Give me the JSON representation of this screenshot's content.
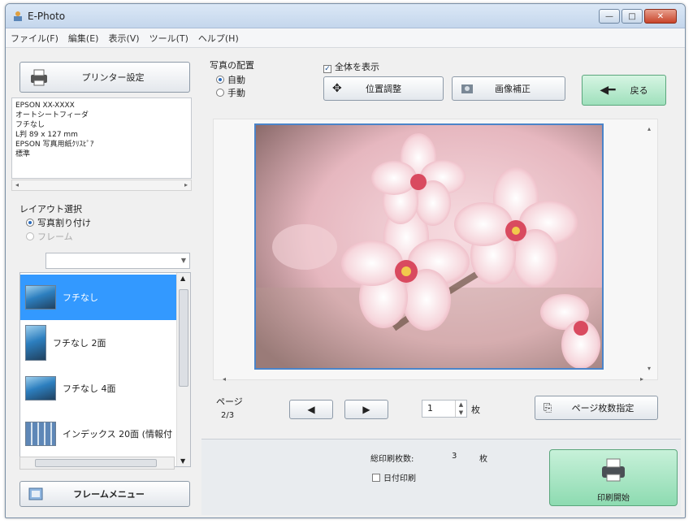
{
  "window": {
    "title": "E-Photo"
  },
  "window_controls": {
    "minimize": "—",
    "maximize": "□",
    "close": "✕"
  },
  "menu": [
    "ファイル(F)",
    "編集(E)",
    "表示(V)",
    "ツール(T)",
    "ヘルプ(H)"
  ],
  "left": {
    "printer_settings_label": "プリンター設定",
    "printer_info": [
      "EPSON XX-XXXX",
      "オートシートフィーダ",
      "フチなし",
      "L判 89 x 127 mm",
      "EPSON 写真用紙ｸﾘｽﾋﾟｱ",
      "標準"
    ],
    "layout_heading": "レイアウト選択",
    "layout_options": [
      {
        "label": "写真割り付け",
        "selected": true
      },
      {
        "label": "フレーム",
        "selected": false
      }
    ],
    "layouts": [
      {
        "label": "フチなし",
        "selected": true
      },
      {
        "label": "フチなし 2面",
        "selected": false
      },
      {
        "label": "フチなし 4面",
        "selected": false
      },
      {
        "label": "インデックス 20面 (情報付",
        "selected": false
      }
    ],
    "frame_menu_label": "フレームメニュー"
  },
  "placement": {
    "heading": "写真の配置",
    "options": [
      {
        "label": "自動",
        "selected": true
      },
      {
        "label": "手動",
        "selected": false
      }
    ]
  },
  "toolbar": {
    "show_all_label": "全体を表示",
    "show_all_checked": true,
    "position_adjust_label": "位置調整",
    "image_correction_label": "画像補正",
    "back_label": "戻る"
  },
  "paging": {
    "page_label": "ページ",
    "page_value": "2/3",
    "copies_value": "1",
    "copies_unit": "枚",
    "page_copies_button": "ページ枚数指定"
  },
  "bottom": {
    "total_prints_label": "総印刷枚数:",
    "total_prints_value": "3",
    "total_prints_unit": "枚",
    "date_print_label": "日付印刷",
    "date_print_checked": false,
    "print_start_label": "印刷開始"
  },
  "colors": {
    "accent_blue": "#3399ff",
    "back_green": "#9fe0bc",
    "print_green": "#8ddbb1",
    "photo_border": "#4b84c9"
  },
  "icons": {
    "app": "app-icon",
    "printer": "printer-icon",
    "move": "move-arrows-icon",
    "correction": "image-correction-icon",
    "back": "back-arrow-icon",
    "prev": "prev-page-icon",
    "next": "next-page-icon",
    "pages": "pages-icon",
    "frame_menu": "frame-icon",
    "print": "printer-large-icon"
  }
}
